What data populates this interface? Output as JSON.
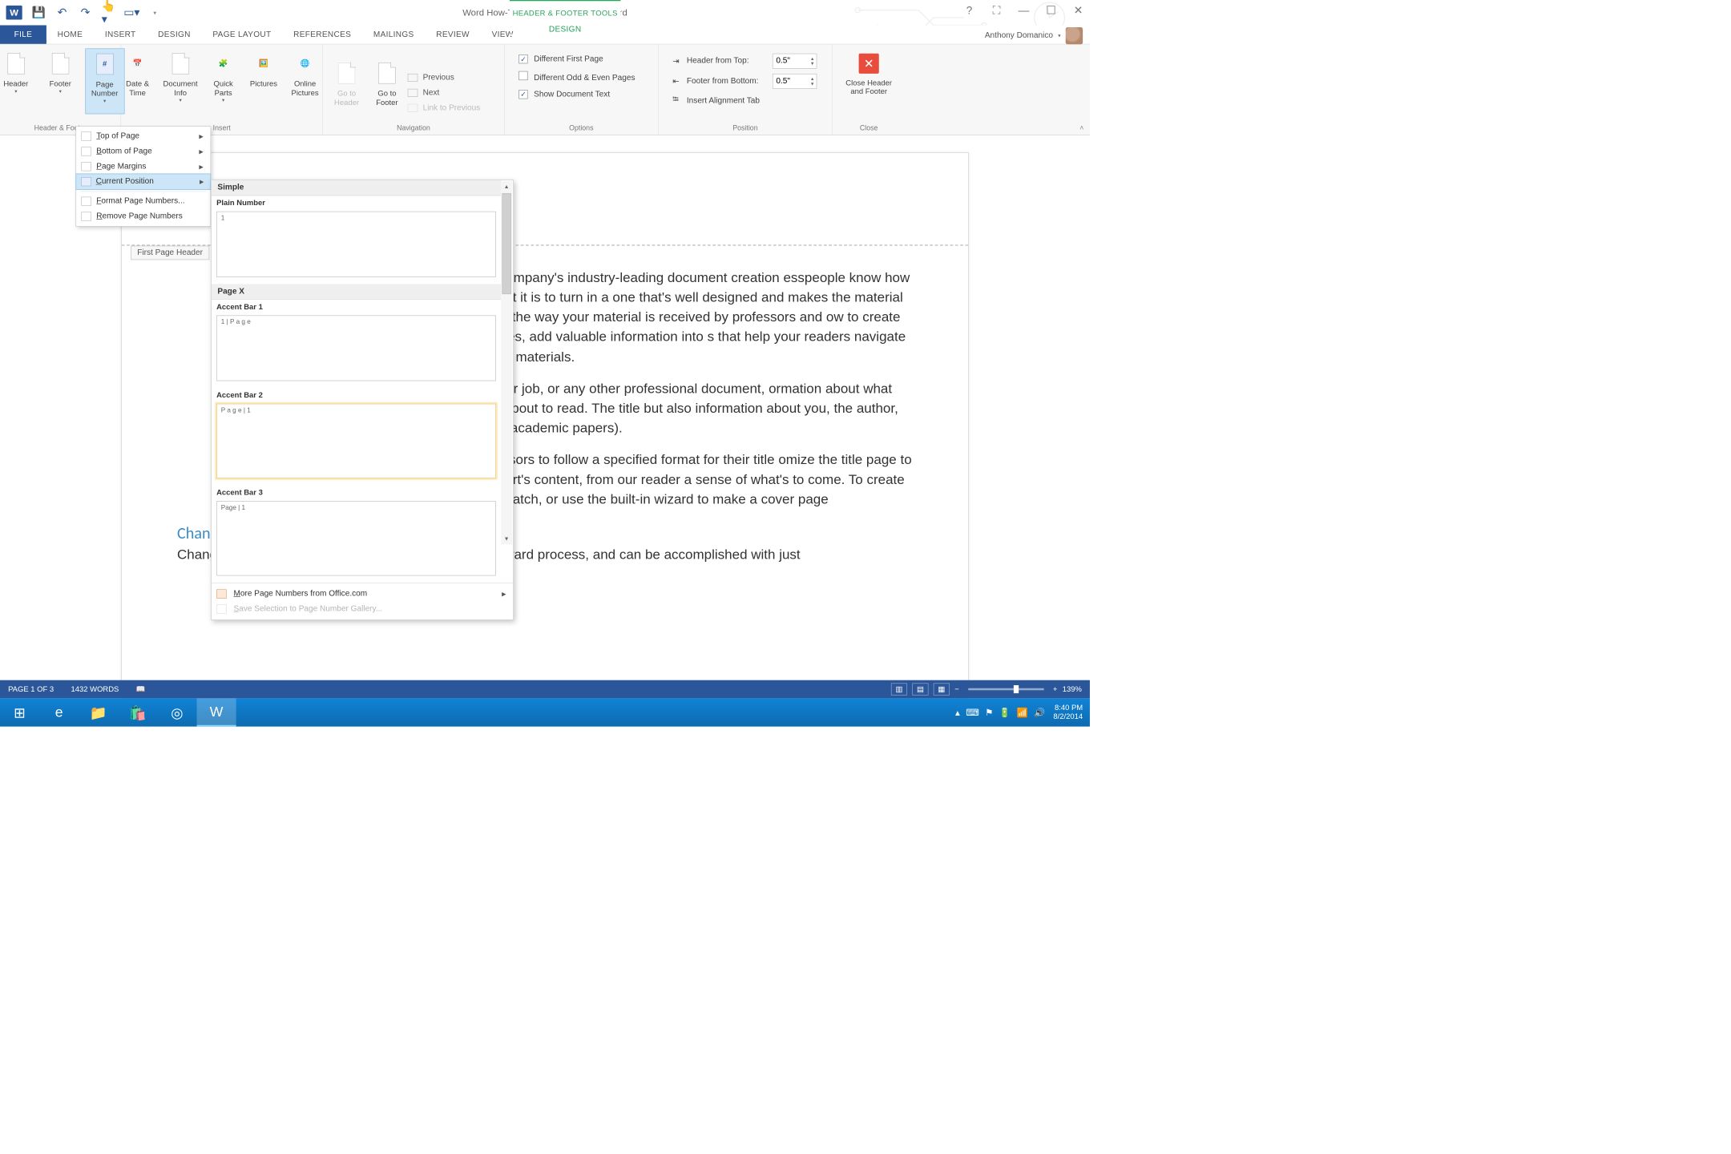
{
  "titlebar": {
    "title": "Word How-To Article August 2014 - Word",
    "context_tools_label": "HEADER & FOOTER TOOLS"
  },
  "tabs": {
    "file": "FILE",
    "home": "HOME",
    "insert": "INSERT",
    "design": "DESIGN",
    "page_layout": "PAGE LAYOUT",
    "references": "REFERENCES",
    "mailings": "MAILINGS",
    "review": "REVIEW",
    "view": "VIEW",
    "context_design": "DESIGN"
  },
  "user": {
    "name": "Anthony Domanico"
  },
  "ribbon": {
    "groups": {
      "header_footer": "Header & Footer",
      "insert": "Insert",
      "navigation": "Navigation",
      "options": "Options",
      "position": "Position",
      "close": "Close"
    },
    "buttons": {
      "header": "Header",
      "footer": "Footer",
      "page_number": "Page Number",
      "date_time": "Date & Time",
      "document_info": "Document Info",
      "quick_parts": "Quick Parts",
      "pictures": "Pictures",
      "online_pictures": "Online Pictures",
      "goto_header": "Go to Header",
      "goto_footer": "Go to Footer",
      "previous": "Previous",
      "next": "Next",
      "link_previous": "Link to Previous",
      "diff_first": "Different First Page",
      "diff_odd_even": "Different Odd & Even Pages",
      "show_doc_text": "Show Document Text",
      "header_from_top": "Header from Top:",
      "footer_from_bottom": "Footer from Bottom:",
      "insert_align_tab": "Insert Alignment Tab",
      "close_hf1": "Close Header",
      "close_hf2": "and Footer"
    },
    "values": {
      "header_from_top": "0.5\"",
      "footer_from_bottom": "0.5\""
    }
  },
  "page_number_menu": {
    "top": "Top of Page",
    "bottom": "Bottom of Page",
    "margins": "Page Margins",
    "current": "Current Position",
    "format": "Format Page Numbers...",
    "remove": "Remove Page Numbers"
  },
  "gallery": {
    "simple_header": "Simple",
    "plain_number": "Plain Number",
    "plain_sample": "1",
    "page_x_header": "Page X",
    "accent1": "Accent Bar 1",
    "accent1_sample": "1 | P a g e",
    "accent2": "Accent Bar 2",
    "accent2_sample": "P a g e  | 1",
    "accent3": "Accent Bar 3",
    "accent3_sample": "Page |  1",
    "more": "More Page Numbers from Office.com",
    "save_selection": "Save Selection to Page Number Gallery..."
  },
  "document": {
    "header_tab": "First Page Header",
    "para1": "B, the company's industry-leading document creation esspeople know how important it is to turn in a one that's well designed and makes the material pop. act the way your material is received by professors and ow to create title pages, add valuable information into s that help your readers navigate lengthier materials.",
    "para2": "rt for your job, or any other professional document, ormation about what they're about to read. The title but also information about you, the author, such as academic papers).",
    "para3": "d professors to follow a specified format for their title omize the title page to your heart's content, from our reader a sense of what's to come. To create a cover ratch, or use the built-in wizard to make a cover page",
    "heading": "Changing the Font",
    "para4": "Changing fonts on your title page is a pretty straightforward process, and can be accomplished with just"
  },
  "statusbar": {
    "page": "PAGE 1 OF 3",
    "words": "1432 WORDS",
    "zoom": "139%"
  },
  "taskbar": {
    "time": "8:40 PM",
    "date": "8/2/2014"
  }
}
